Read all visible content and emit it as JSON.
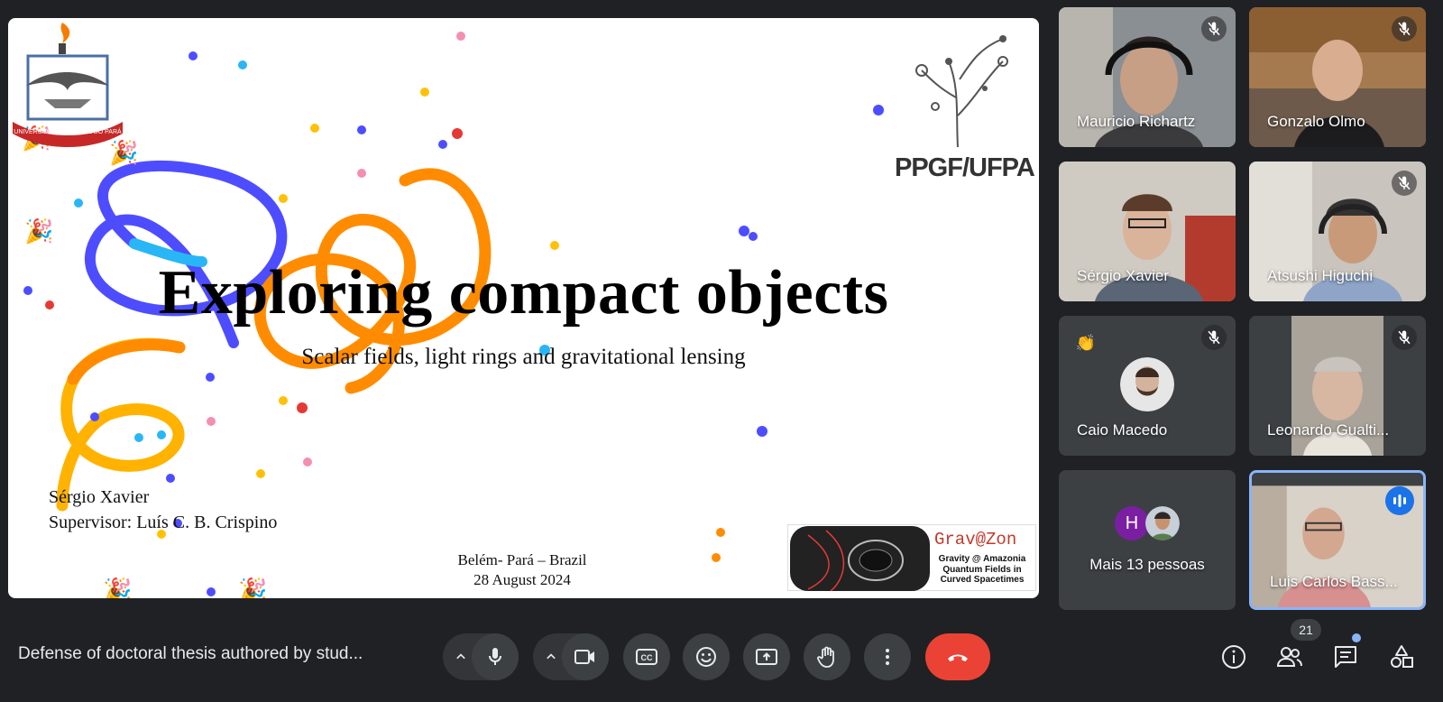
{
  "slide": {
    "title": "Exploring compact objects",
    "subtitle": "Scalar fields, light rings and gravitational lensing",
    "author": "Sérgio Xavier",
    "supervisor": "Supervisor: Luís C. B. Crispino",
    "location": "Belém- Pará – Brazil",
    "date": "28 August 2024",
    "left_logo_text": "UNIVERSIDADE FEDERAL DO PARÁ",
    "right_logo_text": "PPGF/UFPA",
    "partner_logo": {
      "name": "Grav@Zon",
      "line1": "Gravity @ Amazonia",
      "line2": "Quantum Fields in",
      "line3": "Curved Spacetimes"
    }
  },
  "participants": [
    {
      "name": "Mauricio Richartz",
      "muted": true
    },
    {
      "name": "Gonzalo Olmo",
      "muted": true
    },
    {
      "name": "Sérgio Xavier",
      "muted": false
    },
    {
      "name": "Atsushi Higuchi",
      "muted": true
    },
    {
      "name": "Caio Macedo",
      "muted": true,
      "reaction": "👏"
    },
    {
      "name": "Leonardo Gualti...",
      "muted": true
    },
    {
      "name": "Mais 13 pessoas",
      "avatar_letter": "H"
    },
    {
      "name": "Luis Carlos Bass...",
      "speaking": true
    }
  ],
  "meeting": {
    "title": "Defense of doctoral thesis authored by stud...",
    "participant_count": "21"
  },
  "colors": {
    "background": "#202124",
    "control": "#3c4043",
    "end_call": "#ea4335",
    "active_border": "#8ab4f8",
    "speaking": "#1a73e8",
    "avatar_h": "#7b1fa2"
  },
  "icons": {
    "controls": [
      "chevron-up-icon",
      "mic-icon",
      "chevron-up-icon",
      "camera-icon",
      "captions-icon",
      "emoji-icon",
      "present-icon",
      "hand-icon",
      "more-vert-icon",
      "end-call-icon"
    ],
    "right": [
      "info-icon",
      "people-icon",
      "chat-icon",
      "activities-icon"
    ]
  }
}
